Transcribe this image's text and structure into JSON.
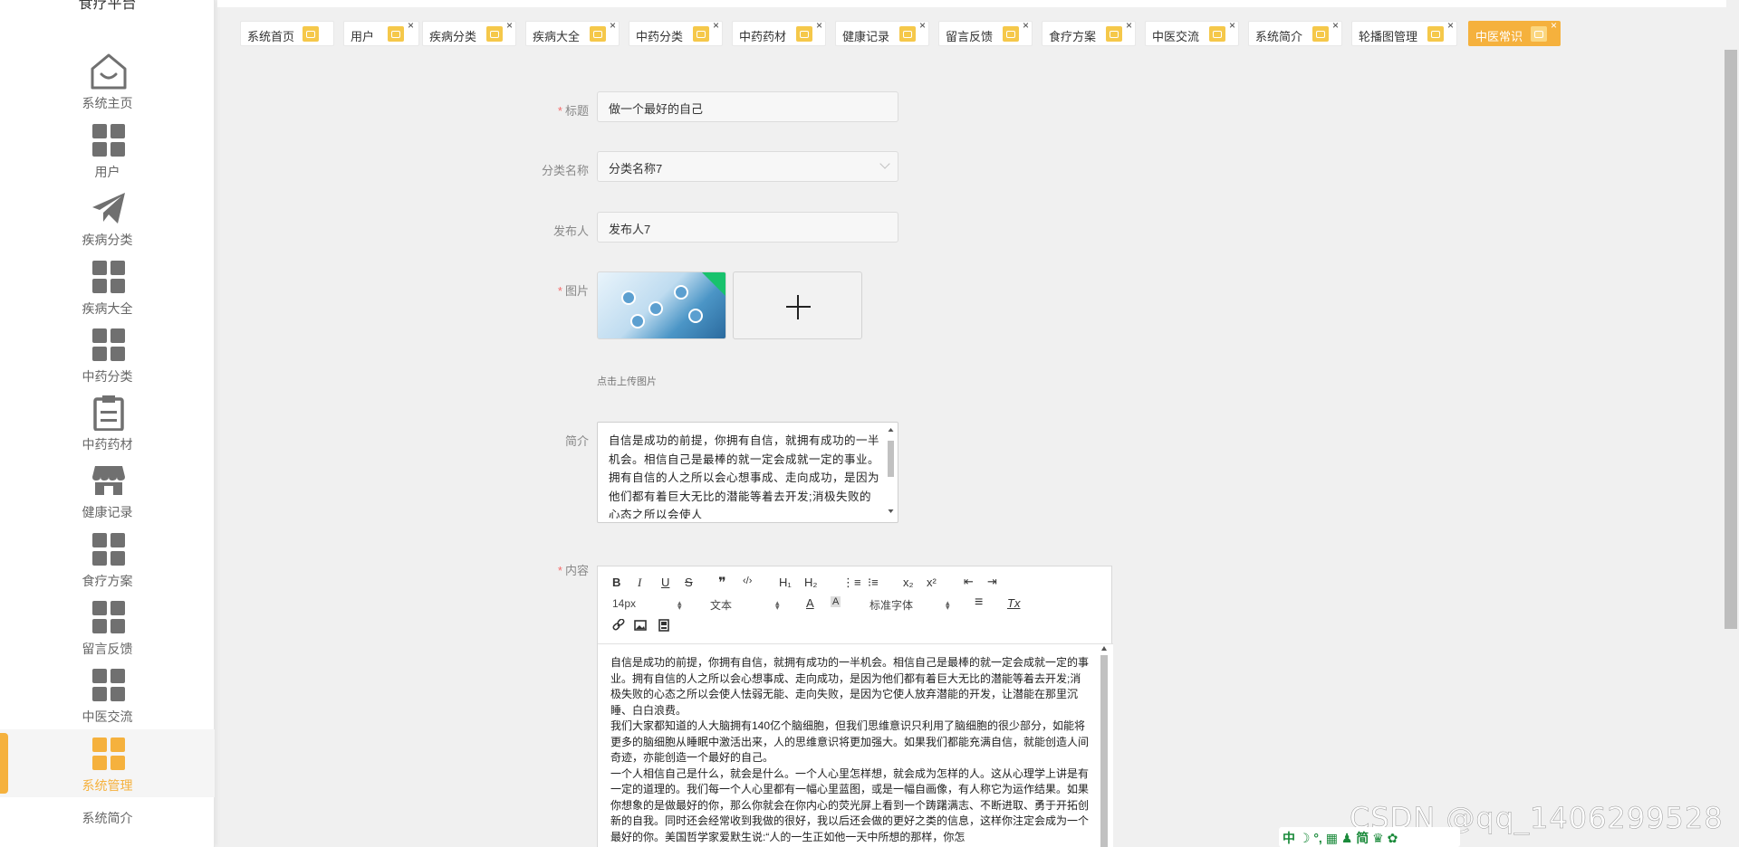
{
  "app": {
    "title": "食疗平台"
  },
  "sidebar": {
    "items": [
      {
        "label": "系统主页",
        "icon": "home-icon"
      },
      {
        "label": "用户",
        "icon": "grid-icon"
      },
      {
        "label": "疾病分类",
        "icon": "paper-plane-icon"
      },
      {
        "label": "疾病大全",
        "icon": "grid-icon"
      },
      {
        "label": "中药分类",
        "icon": "grid-icon"
      },
      {
        "label": "中药药材",
        "icon": "clipboard-icon"
      },
      {
        "label": "健康记录",
        "icon": "store-icon"
      },
      {
        "label": "食疗方案",
        "icon": "grid-icon"
      },
      {
        "label": "留言反馈",
        "icon": "grid-icon"
      },
      {
        "label": "中医交流",
        "icon": "grid-icon"
      },
      {
        "label": "系统管理",
        "icon": "grid-icon",
        "active": true
      },
      {
        "label": "系统简介",
        "icon": "none"
      }
    ]
  },
  "tabs": [
    {
      "label": "系统首页"
    },
    {
      "label": "用户"
    },
    {
      "label": "疾病分类"
    },
    {
      "label": "疾病大全"
    },
    {
      "label": "中药分类"
    },
    {
      "label": "中药药材"
    },
    {
      "label": "健康记录"
    },
    {
      "label": "留言反馈"
    },
    {
      "label": "食疗方案"
    },
    {
      "label": "中医交流"
    },
    {
      "label": "系统简介"
    },
    {
      "label": "轮播图管理"
    },
    {
      "label": "中医常识",
      "active": true
    }
  ],
  "tab_close_glyph": "×",
  "form": {
    "title": {
      "label": "标题",
      "value": "做一个最好的自己",
      "required": true
    },
    "category": {
      "label": "分类名称",
      "value": "分类名称7"
    },
    "publisher": {
      "label": "发布人",
      "value": "发布人7"
    },
    "image": {
      "label": "图片",
      "required": true,
      "hint": "点击上传图片"
    },
    "summary": {
      "label": "简介",
      "text": "自信是成功的前提，你拥有自信，就拥有成功的一半机会。相信自己是最棒的就一定会成就一定的事业。拥有自信的人之所以会心想事成、走向成功，是因为他们都有着巨大无比的潜能等着去开发;消极失败的心态之所以会使人"
    },
    "content": {
      "label": "内容",
      "required": true,
      "paragraphs": [
        "自信是成功的前提，你拥有自信，就拥有成功的一半机会。相信自己是最棒的就一定会成就一定的事业。拥有自信的人之所以会心想事成、走向成功，是因为他们都有着巨大无比的潜能等着去开发;消极失败的心态之所以会使人怯弱无能、走向失败，是因为它使人放弃潜能的开发，让潜能在那里沉睡、白白浪费。",
        "我们大家都知道的人大脑拥有140亿个脑细胞，但我们思维意识只利用了脑细胞的很少部分，如能将更多的脑细胞从睡眠中激活出来，人的思维意识将更加强大。如果我们都能充满自信，就能创造人间奇迹，亦能创造一个最好的自己。",
        "一个人相信自己是什么，就会是什么。一个人心里怎样想，就会成为怎样的人。这从心理学上讲是有一定的道理的。我们每一个人心里都有一幅心里蓝图，或是一幅自画像，有人称它为运作结果。如果你想象的是做最好的你，那么你就会在你内心的荧光屏上看到一个踌躇满志、不断进取、勇于开拓创新的自我。同时还会经常收到我做的很好，我以后还会做的更好之类的信息，这样你注定会成为一个最好的你。美国哲学家爱默生说:“人的一生正如他一天中所想的那样，你怎"
      ]
    }
  },
  "editor_toolbar": {
    "bold": "B",
    "italic": "I",
    "underline": "U",
    "strike": "S",
    "quote": "❞",
    "code": "‹/›",
    "h1": "H₁",
    "h2": "H₂",
    "ordered_list": "⋮≡",
    "bullet_list": "⁝≡",
    "subscript": "x₂",
    "superscript": "x²",
    "outdent": "⇤",
    "indent": "⇥",
    "font_size": "14px",
    "text_type": "文本",
    "font_color": "A",
    "bg_color": "A",
    "font_family": "标准字体",
    "align": "≡",
    "clear": "Tx"
  },
  "watermark": "CSDN @qq_1406299528",
  "ime": {
    "text": "中 ☽ °, ▦ ♟ 简 ♛ ✿"
  },
  "colors": {
    "accent": "#f5b13d",
    "tab_icon": "#f5c84a"
  }
}
